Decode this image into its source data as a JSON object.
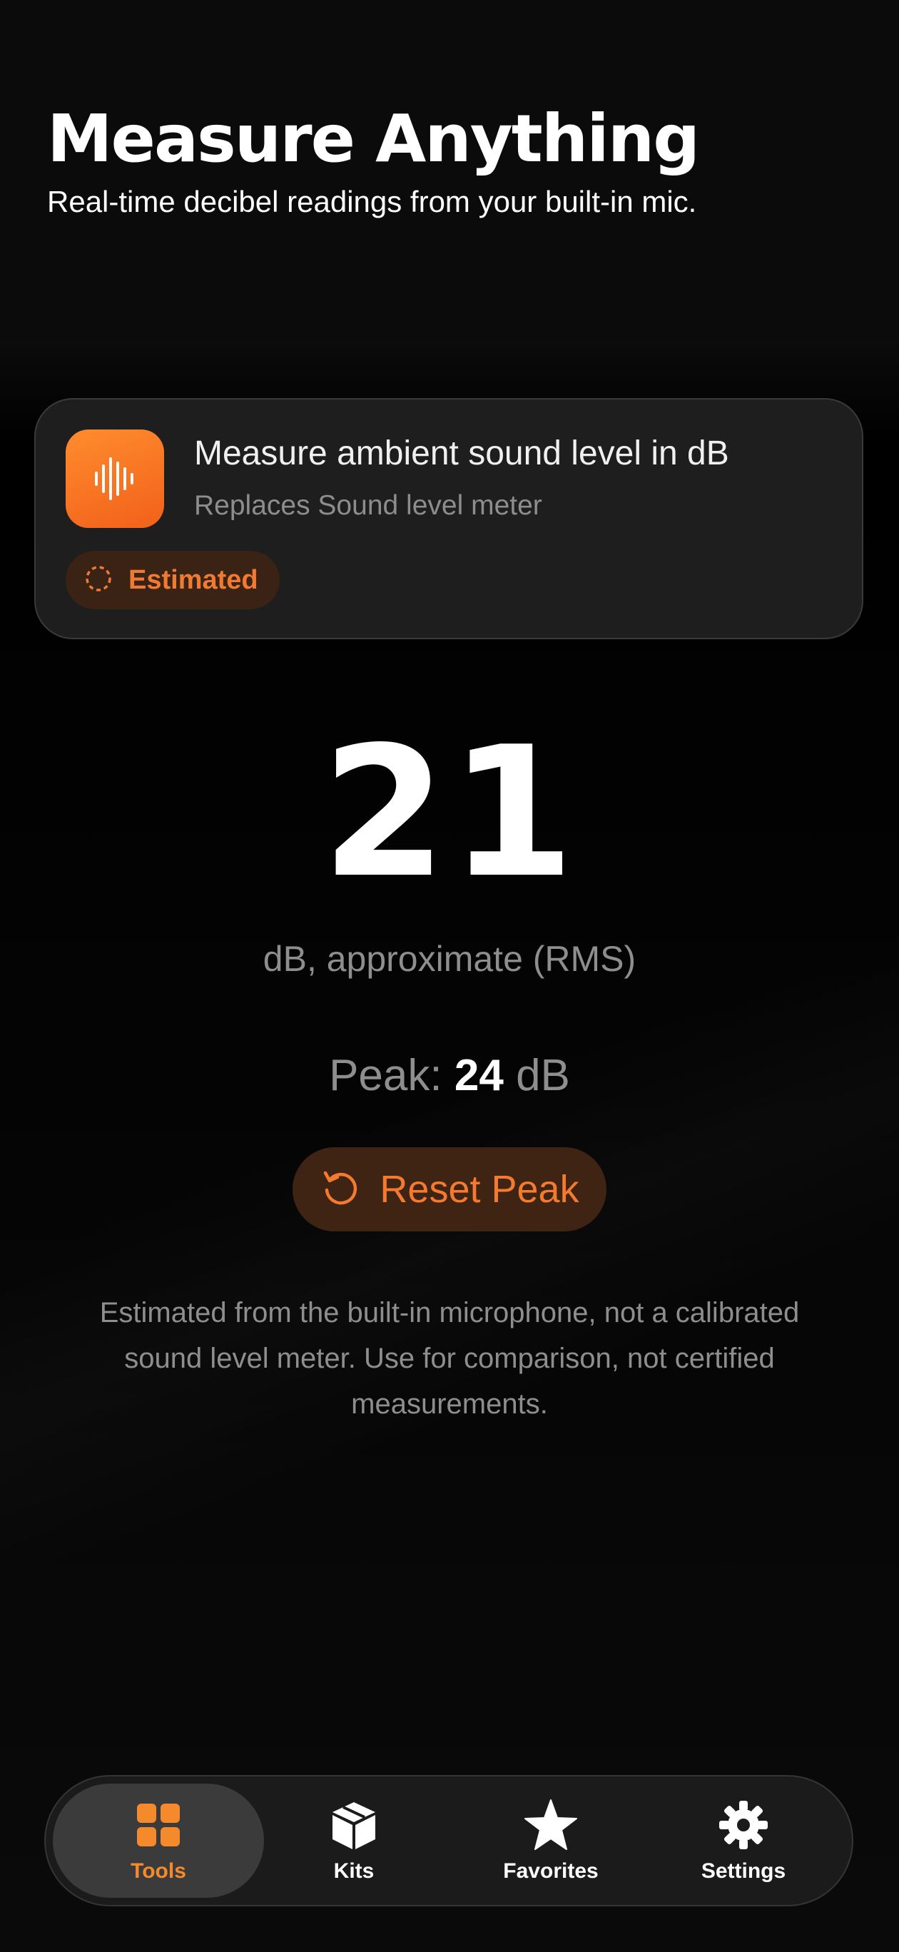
{
  "header": {
    "title": "Measure Anything",
    "subtitle": "Real-time decibel readings from your built-in mic."
  },
  "tool_card": {
    "icon": "waveform-icon",
    "title": "Measure ambient sound level in dB",
    "subtitle": "Replaces Sound level meter",
    "badge": {
      "icon": "dashed-circle-icon",
      "label": "Estimated"
    }
  },
  "meter": {
    "reading": "21",
    "unit_label": "dB, approximate (RMS)",
    "peak_prefix": "Peak:",
    "peak_value": "24",
    "peak_unit": "dB"
  },
  "reset_button": {
    "icon": "reset-arrow-icon",
    "label": "Reset Peak"
  },
  "disclaimer": "Estimated from the built-in microphone, not a calibrated sound level meter. Use for comparison, not certified measurements.",
  "tab_bar": {
    "tabs": [
      {
        "label": "Tools",
        "icon": "grid-icon",
        "active": true
      },
      {
        "label": "Kits",
        "icon": "box-icon",
        "active": false
      },
      {
        "label": "Favorites",
        "icon": "star-icon",
        "active": false
      },
      {
        "label": "Settings",
        "icon": "gear-icon",
        "active": false
      }
    ]
  },
  "colors": {
    "accent": "#f47a30",
    "background": "#000000",
    "card": "#1e1e1e"
  }
}
